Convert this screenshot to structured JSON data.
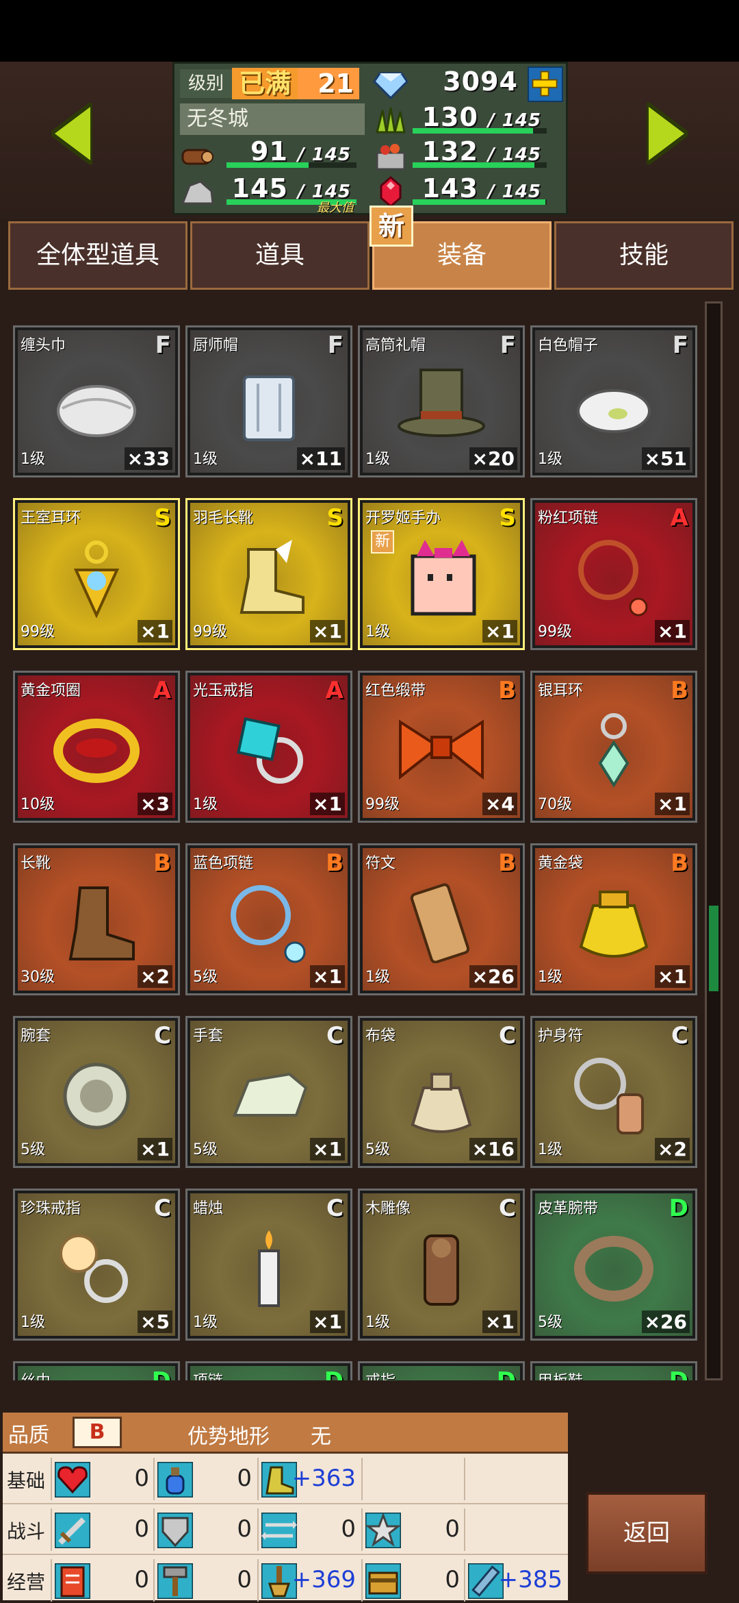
{
  "colors": {
    "grade_S": "#ffe000",
    "grade_A": "#ff3030",
    "grade_B": "#ff7a20",
    "grade_C": "#f0f0f0",
    "grade_D": "#30ff50",
    "grade_F": "#e0e0e0",
    "bg_F": "#4a4a4a",
    "bg_S": "#d8b31a",
    "bg_A": "#a81822",
    "bg_B": "#b45026",
    "bg_C": "#7d6e3c",
    "bg_D": "#3f7a4a"
  },
  "header": {
    "level_label": "级别",
    "level_max": "已满",
    "level_value": "21",
    "city_name": "无冬城",
    "gems": "3094",
    "max_badge": "最大值",
    "new_badge": "新",
    "stats": [
      {
        "icon": "wood-icon",
        "value": "91",
        "max": "145",
        "fill": 0.63
      },
      {
        "icon": "stone-icon",
        "value": "145",
        "max": "145",
        "fill": 1.0
      },
      {
        "icon": "grass-icon",
        "value": "130",
        "max": "145",
        "fill": 0.9
      },
      {
        "icon": "basket-icon",
        "value": "132",
        "max": "145",
        "fill": 0.91
      },
      {
        "icon": "ruby-icon",
        "value": "143",
        "max": "145",
        "fill": 0.99
      }
    ]
  },
  "tabs": [
    {
      "label": "全体型道具",
      "active": false
    },
    {
      "label": "道具",
      "active": false
    },
    {
      "label": "装备",
      "active": true
    },
    {
      "label": "技能",
      "active": false
    }
  ],
  "items": [
    {
      "name": "缠头巾",
      "grade": "F",
      "level": "1级",
      "count": "×33",
      "icon": "turban-icon"
    },
    {
      "name": "厨师帽",
      "grade": "F",
      "level": "1级",
      "count": "×11",
      "icon": "chef-hat-icon"
    },
    {
      "name": "高筒礼帽",
      "grade": "F",
      "level": "1级",
      "count": "×20",
      "icon": "top-hat-icon"
    },
    {
      "name": "白色帽子",
      "grade": "F",
      "level": "1级",
      "count": "×51",
      "icon": "white-hat-icon"
    },
    {
      "name": "王室耳环",
      "grade": "S",
      "level": "99级",
      "count": "×1",
      "icon": "royal-earring-icon"
    },
    {
      "name": "羽毛长靴",
      "grade": "S",
      "level": "99级",
      "count": "×1",
      "icon": "feather-boots-icon"
    },
    {
      "name": "开罗姬手办",
      "grade": "S",
      "level": "1级",
      "count": "×1",
      "icon": "kairo-figure-icon",
      "new": "新"
    },
    {
      "name": "粉红项链",
      "grade": "A",
      "level": "99级",
      "count": "×1",
      "icon": "pink-necklace-icon"
    },
    {
      "name": "黄金项圈",
      "grade": "A",
      "level": "10级",
      "count": "×3",
      "icon": "gold-collar-icon"
    },
    {
      "name": "光玉戒指",
      "grade": "A",
      "level": "1级",
      "count": "×1",
      "icon": "jewel-ring-icon"
    },
    {
      "name": "红色缎带",
      "grade": "B",
      "level": "99级",
      "count": "×4",
      "icon": "red-ribbon-icon"
    },
    {
      "name": "银耳环",
      "grade": "B",
      "level": "70级",
      "count": "×1",
      "icon": "silver-earring-icon"
    },
    {
      "name": "长靴",
      "grade": "B",
      "level": "30级",
      "count": "×2",
      "icon": "long-boots-icon"
    },
    {
      "name": "蓝色项链",
      "grade": "B",
      "level": "5级",
      "count": "×1",
      "icon": "blue-necklace-icon"
    },
    {
      "name": "符文",
      "grade": "B",
      "level": "1级",
      "count": "×26",
      "icon": "rune-icon"
    },
    {
      "name": "黄金袋",
      "grade": "B",
      "level": "1级",
      "count": "×1",
      "icon": "gold-bag-icon"
    },
    {
      "name": "腕套",
      "grade": "C",
      "level": "5级",
      "count": "×1",
      "icon": "wristband-icon"
    },
    {
      "name": "手套",
      "grade": "C",
      "level": "5级",
      "count": "×1",
      "icon": "glove-icon"
    },
    {
      "name": "布袋",
      "grade": "C",
      "level": "5级",
      "count": "×16",
      "icon": "cloth-bag-icon"
    },
    {
      "name": "护身符",
      "grade": "C",
      "level": "1级",
      "count": "×2",
      "icon": "amulet-icon"
    },
    {
      "name": "珍珠戒指",
      "grade": "C",
      "level": "1级",
      "count": "×5",
      "icon": "pearl-ring-icon"
    },
    {
      "name": "蜡烛",
      "grade": "C",
      "level": "1级",
      "count": "×1",
      "icon": "candle-icon"
    },
    {
      "name": "木雕像",
      "grade": "C",
      "level": "1级",
      "count": "×1",
      "icon": "wood-statue-icon"
    },
    {
      "name": "皮革腕带",
      "grade": "D",
      "level": "5级",
      "count": "×26",
      "icon": "leather-band-icon"
    },
    {
      "name": "丝巾",
      "grade": "D",
      "level": "",
      "count": "",
      "icon": "scarf-icon"
    },
    {
      "name": "项链",
      "grade": "D",
      "level": "",
      "count": "",
      "icon": "necklace-icon"
    },
    {
      "name": "戒指",
      "grade": "D",
      "level": "",
      "count": "",
      "icon": "ring-icon"
    },
    {
      "name": "甲板鞋",
      "grade": "D",
      "level": "",
      "count": "",
      "icon": "deck-shoes-icon"
    }
  ],
  "info": {
    "quality_label": "品质",
    "quality_value": "B",
    "terrain_label": "优势地形",
    "terrain_value": "无",
    "rows": [
      {
        "label": "基础",
        "cells": [
          {
            "icon": "heart-icon",
            "value": "0"
          },
          {
            "icon": "potion-icon",
            "value": "0"
          },
          {
            "icon": "boot-icon",
            "value": "+363"
          },
          {
            "icon": "",
            "value": ""
          },
          {
            "icon": "",
            "value": ""
          }
        ]
      },
      {
        "label": "战斗",
        "cells": [
          {
            "icon": "sword-icon",
            "value": "0"
          },
          {
            "icon": "shield-icon",
            "value": "0"
          },
          {
            "icon": "arrows-icon",
            "value": "0"
          },
          {
            "icon": "star-icon",
            "value": "0"
          },
          {
            "icon": "",
            "value": ""
          }
        ]
      },
      {
        "label": "经营",
        "cells": [
          {
            "icon": "book-icon",
            "value": "0"
          },
          {
            "icon": "hammer-icon",
            "value": "0"
          },
          {
            "icon": "shovel-icon",
            "value": "+369"
          },
          {
            "icon": "chest-icon",
            "value": "0"
          },
          {
            "icon": "wrench-icon",
            "value": "+385"
          }
        ]
      }
    ]
  },
  "back_button": "返回",
  "scroll": {
    "position": 0.56,
    "size": 0.08
  }
}
